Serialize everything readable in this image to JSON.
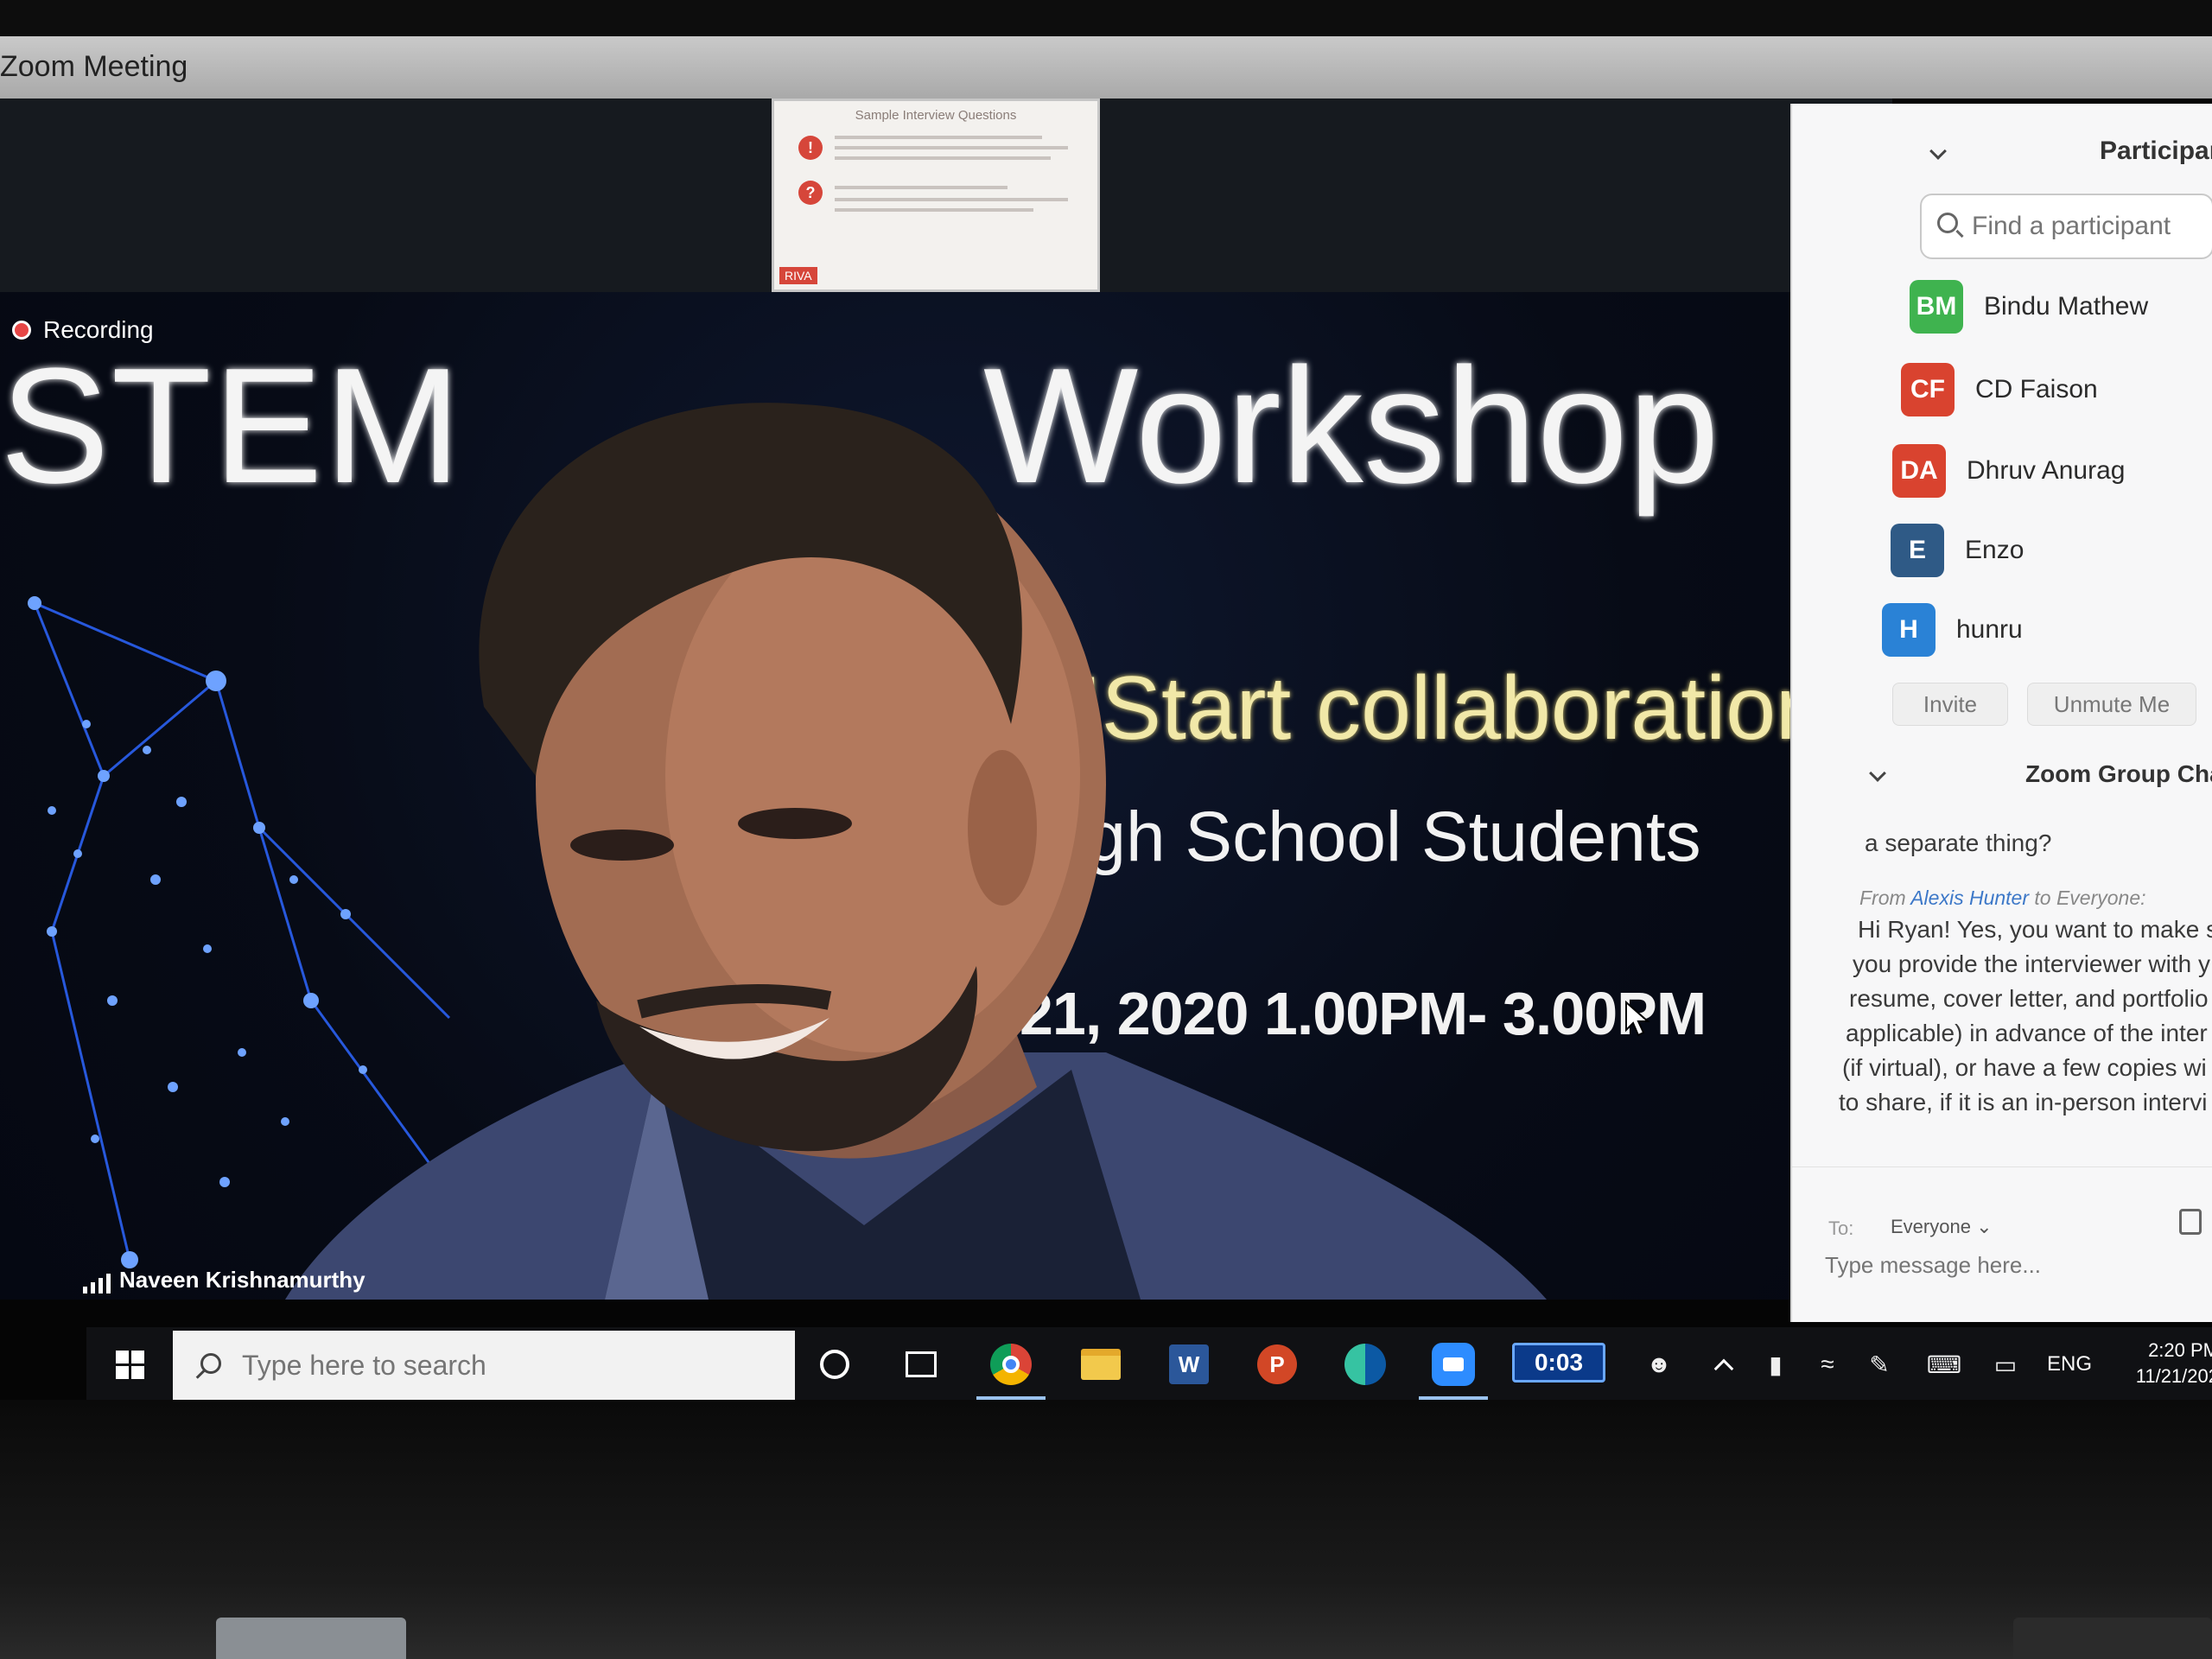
{
  "window": {
    "title": "Zoom Meeting"
  },
  "shared_screen": {
    "thumbnail_title": "Sample Interview Questions",
    "thumbnail_tag": "RIVA"
  },
  "video": {
    "recording_label": "Recording",
    "slide_title_left": "STEM",
    "slide_title_right": "Workshop",
    "slide_subtitle": "MStart collaboration",
    "slide_audience": "High School Students",
    "slide_datetime": "21, 2020 1.00PM- 3.00PM",
    "speaker_name": "Naveen Krishnamurthy"
  },
  "participants": {
    "title": "Participar",
    "search_placeholder": "Find a participant",
    "list": [
      {
        "initials": "BM",
        "name": "Bindu Mathew",
        "color": "#3fb34f"
      },
      {
        "initials": "CF",
        "name": "CD Faison",
        "color": "#d9432f"
      },
      {
        "initials": "DA",
        "name": "Dhruv Anurag",
        "color": "#d9432f"
      },
      {
        "initials": "E",
        "name": "Enzo",
        "color": "#2f5a86"
      },
      {
        "initials": "H",
        "name": "hunru",
        "color": "#2a82d6"
      }
    ],
    "invite_label": "Invite",
    "unmute_label": "Unmute Me"
  },
  "chat": {
    "title": "Zoom Group Cha",
    "prev_tail": "a separate thing?",
    "from_prefix": "From",
    "from_name": "Alexis Hunter",
    "from_suffix": "to Everyone:",
    "message_lines": [
      "Hi Ryan! Yes, you want to make s",
      "you provide the interviewer with y",
      "resume, cover letter, and portfolio",
      "applicable) in advance of the inter",
      "(if virtual), or have a few copies wi",
      "to share, if it is an in-person intervi"
    ],
    "to_label": "To:",
    "to_value": "Everyone",
    "input_placeholder": "Type message here..."
  },
  "taskbar": {
    "search_placeholder": "Type here to search",
    "timer": "0:03",
    "language": "ENG",
    "time": "2:20 PM",
    "date": "11/21/202"
  }
}
